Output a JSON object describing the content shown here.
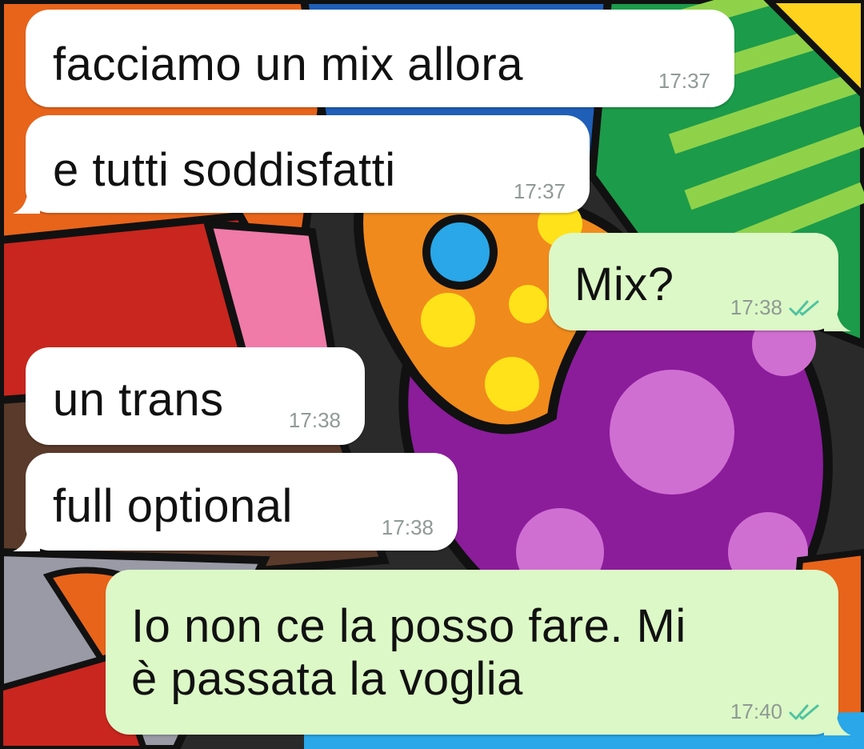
{
  "chat": {
    "messages": [
      {
        "direction": "incoming",
        "text": "facciamo un mix allora",
        "time": "17:37"
      },
      {
        "direction": "incoming",
        "text": "e tutti soddisfatti",
        "time": "17:37"
      },
      {
        "direction": "outgoing",
        "text": "Mix?",
        "time": "17:38",
        "status_icon": "double-check-read-icon"
      },
      {
        "direction": "incoming",
        "text": "un trans",
        "time": "17:38"
      },
      {
        "direction": "incoming",
        "text": "full optional",
        "time": "17:38"
      },
      {
        "direction": "outgoing",
        "text": "Io non ce la posso fare. Mi\nè passata la voglia",
        "time": "17:40",
        "status_icon": "double-check-read-icon"
      }
    ]
  },
  "colors": {
    "incoming_bubble": "#ffffff",
    "outgoing_bubble": "#dcf8c6",
    "timestamp": "#8f9a95",
    "read_check": "#4fc3a1"
  }
}
